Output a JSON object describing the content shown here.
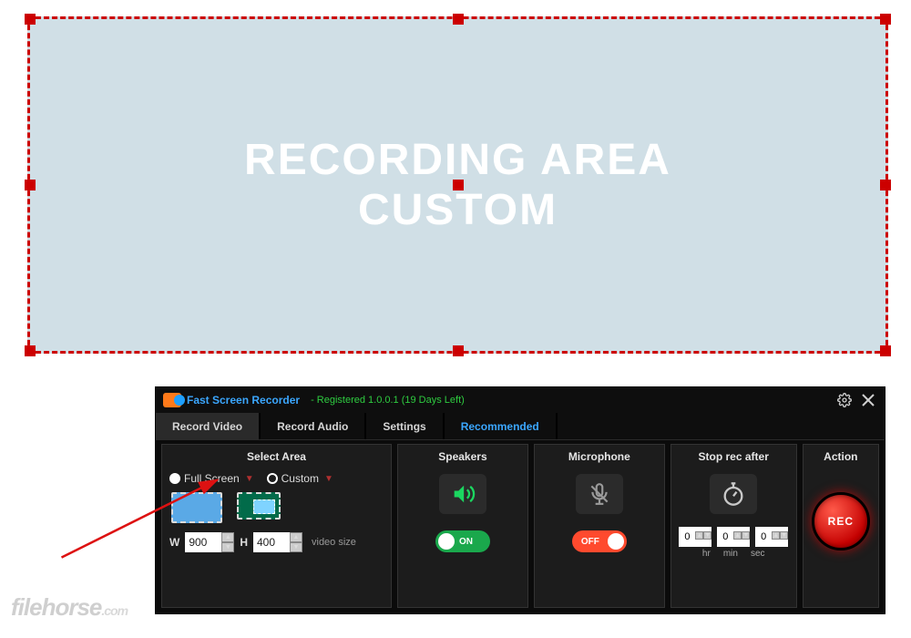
{
  "recording_area": {
    "line1": "RECORDING AREA",
    "line2": "CUSTOM"
  },
  "titlebar": {
    "app_name": "Fast Screen Recorder",
    "registration": "- Registered 1.0.0.1 (19 Days Left)"
  },
  "tabs": {
    "record_video": "Record Video",
    "record_audio": "Record Audio",
    "settings": "Settings",
    "recommended": "Recommended"
  },
  "select_area": {
    "header": "Select Area",
    "full_screen": "Full Screen",
    "custom": "Custom",
    "w_label": "W",
    "h_label": "H",
    "width": "900",
    "height": "400",
    "video_size": "video size"
  },
  "speakers": {
    "header": "Speakers",
    "toggle": "ON"
  },
  "microphone": {
    "header": "Microphone",
    "toggle": "OFF"
  },
  "stop": {
    "header": "Stop rec after",
    "hr": "0",
    "min": "0",
    "sec": "0",
    "hr_label": "hr",
    "min_label": "min",
    "sec_label": "sec"
  },
  "action": {
    "header": "Action",
    "rec": "REC"
  },
  "watermark": {
    "brand": "filehorse",
    "tld": ".com"
  }
}
